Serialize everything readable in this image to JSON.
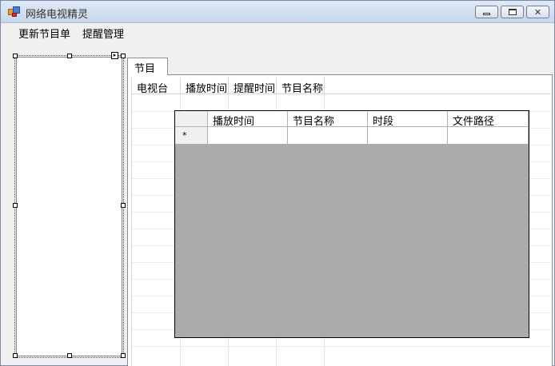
{
  "window": {
    "title": "网络电视精灵"
  },
  "menu": {
    "items": [
      "更新节目单",
      "提醒管理"
    ]
  },
  "tabs": [
    {
      "label": "节目"
    }
  ],
  "program_grid": {
    "columns": [
      "电视台",
      "播放时间",
      "提醒时间",
      "节目名称"
    ]
  },
  "detail_grid": {
    "columns": [
      "播放时间",
      "节目名称",
      "时段",
      "文件路径"
    ],
    "new_row_marker": "*"
  }
}
